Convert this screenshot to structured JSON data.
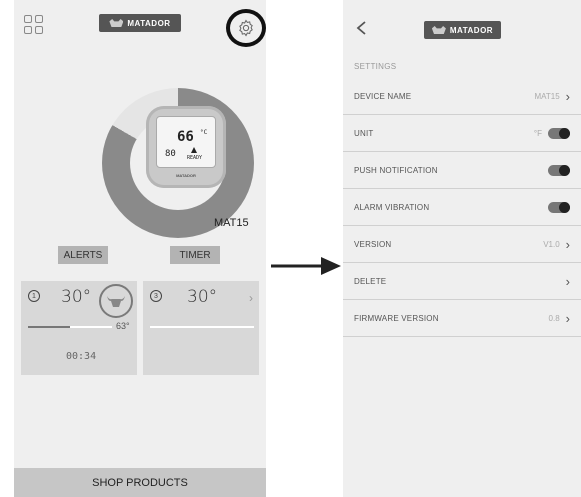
{
  "left_screen": {
    "logo_text": "MATADOR",
    "device_display": {
      "main_temp": "66",
      "unit": "°C",
      "small_temp": "80",
      "status": "READY",
      "brand": "MATADOR"
    },
    "device_name": "MAT15",
    "buttons": {
      "alerts": "ALERTS",
      "timer": "TIMER"
    },
    "probes": [
      {
        "number": "1",
        "temp": "30°",
        "target": "63°",
        "time": "00:34",
        "progress": 0.5
      },
      {
        "number": "3",
        "temp": "30°"
      }
    ],
    "shop_label": "SHOP PRODUCTS"
  },
  "right_screen": {
    "logo_text": "MATADOR",
    "section_title": "SETTINGS",
    "rows": [
      {
        "label": "DEVICE NAME",
        "value": "MAT15",
        "control": "chevron"
      },
      {
        "label": "UNIT",
        "value": "°F",
        "control": "toggle",
        "state": "on"
      },
      {
        "label": "PUSH NOTIFICATION",
        "value": "",
        "control": "toggle",
        "state": "on"
      },
      {
        "label": "ALARM VIBRATION",
        "value": "",
        "control": "toggle",
        "state": "on"
      },
      {
        "label": "VERSION",
        "value": "V1.0",
        "control": "chevron"
      },
      {
        "label": "DELETE",
        "value": "",
        "control": "chevron"
      },
      {
        "label": "FIRMWARE VERSION",
        "value": "0.8",
        "control": "chevron"
      }
    ]
  },
  "icons": [
    "grid-icon",
    "gear-icon",
    "bull-icon",
    "back-icon",
    "chevron-right-icon",
    "arrow-right-icon"
  ],
  "colors": {
    "background": "#efefef",
    "button_gray": "#b3b3b3",
    "card_gray": "#d8d8d8",
    "shop_bar": "#c6c6c6",
    "ring": "#8a8a8a"
  }
}
